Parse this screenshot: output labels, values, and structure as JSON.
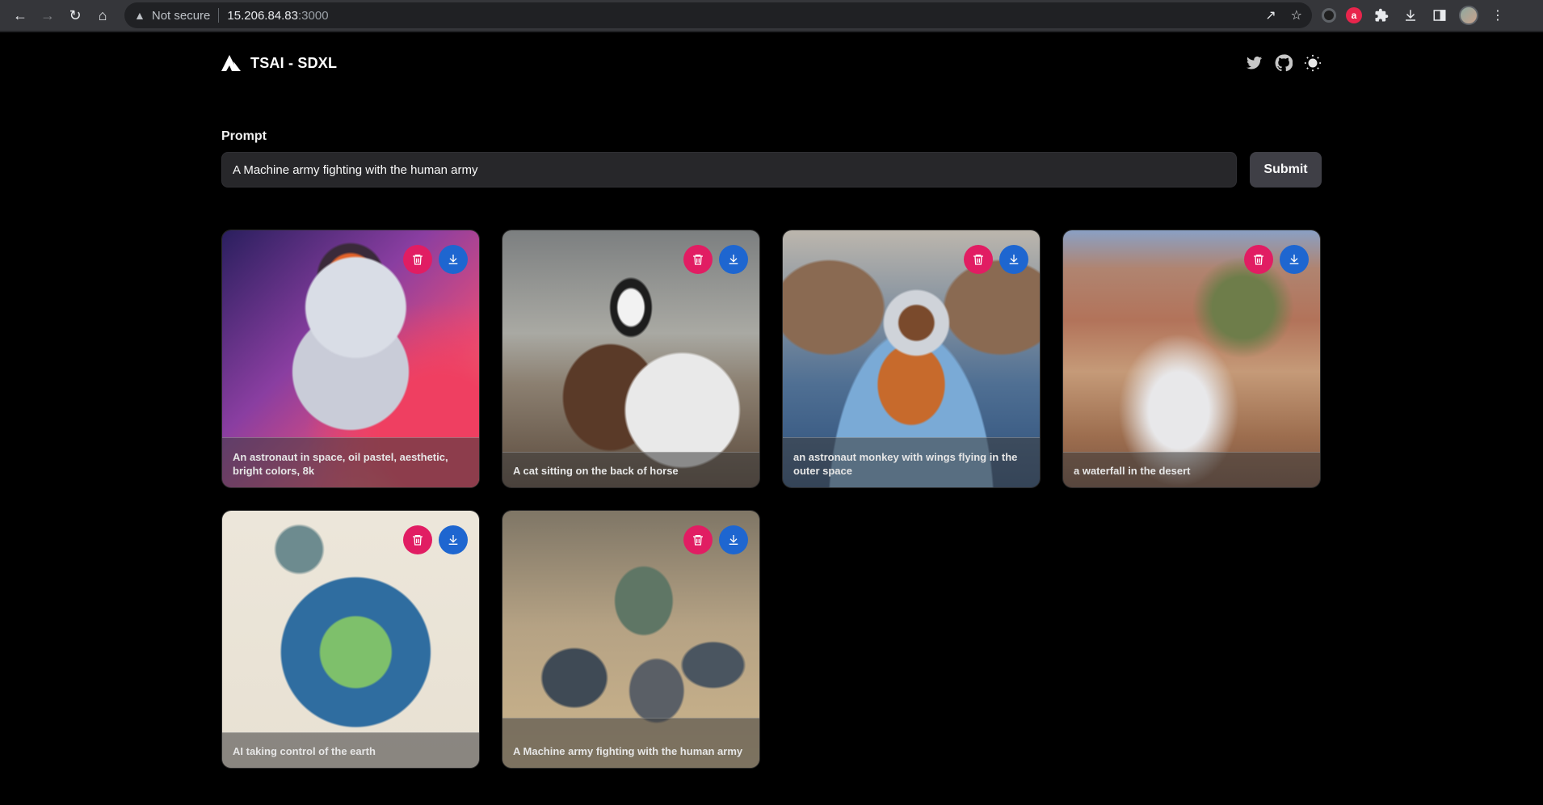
{
  "browser": {
    "security_text": "Not secure",
    "url_host": "15.206.84.83",
    "url_port": ":3000"
  },
  "app": {
    "title": "TSAI - SDXL"
  },
  "prompt": {
    "label": "Prompt",
    "value": "A Machine army fighting with the human army",
    "submit_label": "Submit"
  },
  "gallery": [
    {
      "caption": "An astronaut in space, oil pastel, aesthetic, bright colors, 8k"
    },
    {
      "caption": "A cat sitting on the back of horse"
    },
    {
      "caption": "an astronaut monkey with wings flying in the outer space"
    },
    {
      "caption": "a waterfall in the desert"
    },
    {
      "caption": "AI taking control of the earth"
    },
    {
      "caption": "A Machine army fighting with the human army"
    }
  ],
  "colors": {
    "delete_button": "#e11d63",
    "download_button": "#1e66d0",
    "input_bg": "#27272a",
    "submit_bg": "#3f3f46"
  },
  "icons": [
    "back-icon",
    "forward-icon",
    "reload-icon",
    "home-icon",
    "warning-icon",
    "share-icon",
    "star-icon",
    "puzzle-icon",
    "download-icon",
    "sidebar-icon",
    "menu-icon",
    "twitter-icon",
    "github-icon",
    "sun-icon",
    "trash-icon"
  ]
}
